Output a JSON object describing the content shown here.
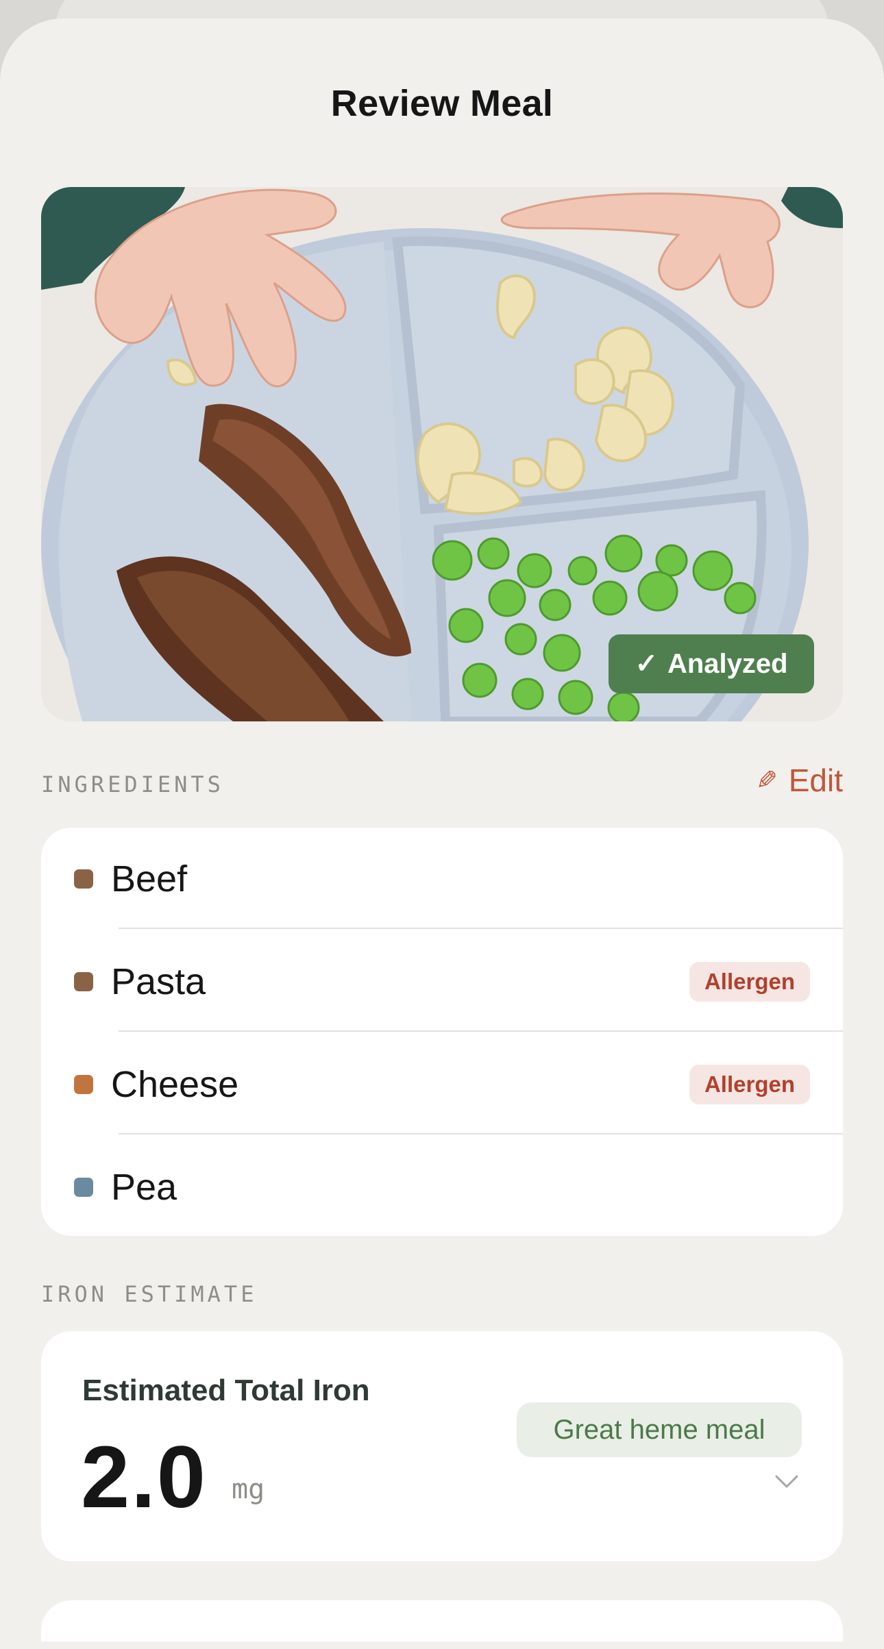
{
  "header": {
    "title": "Review Meal"
  },
  "photo": {
    "alt": "meal-photo",
    "status_badge": {
      "check": "✓",
      "label": "Analyzed",
      "color": "#4f7f4e"
    }
  },
  "ingredients": {
    "section_label": "INGREDIENTS",
    "edit_label": "Edit",
    "edit_icon": "pencil-icon",
    "items": [
      {
        "name": "Beef",
        "color": "#8a6246",
        "allergen": ""
      },
      {
        "name": "Pasta",
        "color": "#8a6246",
        "allergen": "Allergen"
      },
      {
        "name": "Cheese",
        "color": "#c0753e",
        "allergen": "Allergen"
      },
      {
        "name": "Pea",
        "color": "#6b8aa0",
        "allergen": ""
      }
    ]
  },
  "iron": {
    "section_label": "IRON ESTIMATE",
    "card_title": "Estimated Total Iron",
    "value": "2.0",
    "unit": "mg",
    "tag": "Great heme meal",
    "expand_icon": "chevron-down-icon"
  },
  "colors": {
    "accent": "#c0573a",
    "background": "#f1f0ec",
    "success": "#4f7f4e",
    "allergen_text": "#b2402d"
  }
}
